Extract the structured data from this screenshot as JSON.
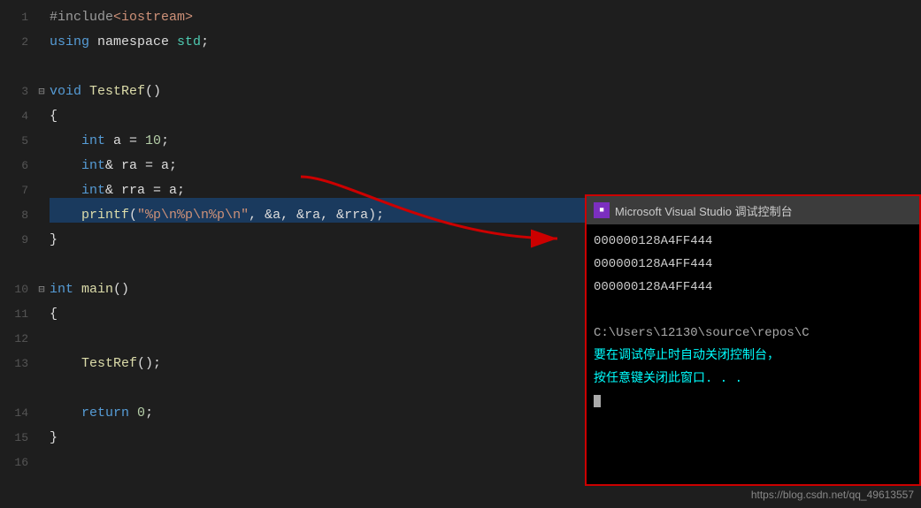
{
  "code": {
    "lines": [
      {
        "id": 1,
        "collapse": false,
        "content": [
          {
            "text": "#include",
            "cls": "preprocessor"
          },
          {
            "text": "<iostream>",
            "cls": "include-file"
          }
        ]
      },
      {
        "id": 2,
        "collapse": false,
        "content": [
          {
            "text": "using",
            "cls": "kw-purple"
          },
          {
            "text": " namespace ",
            "cls": "punct"
          },
          {
            "text": "std",
            "cls": "kw-green"
          },
          {
            "text": ";",
            "cls": "punct"
          }
        ]
      },
      {
        "id": 3,
        "collapse": false,
        "content": []
      },
      {
        "id": 4,
        "collapse": true,
        "content": [
          {
            "text": "void",
            "cls": "kw-blue"
          },
          {
            "text": " ",
            "cls": "punct"
          },
          {
            "text": "TestRef",
            "cls": "kw-yellow"
          },
          {
            "text": "()",
            "cls": "punct"
          }
        ]
      },
      {
        "id": 5,
        "collapse": false,
        "content": [
          {
            "text": "{",
            "cls": "punct"
          }
        ]
      },
      {
        "id": 6,
        "collapse": false,
        "content": [
          {
            "text": "    ",
            "cls": "punct"
          },
          {
            "text": "int",
            "cls": "kw-blue"
          },
          {
            "text": " a = ",
            "cls": "punct"
          },
          {
            "text": "10",
            "cls": "number"
          },
          {
            "text": ";",
            "cls": "punct"
          }
        ]
      },
      {
        "id": 7,
        "collapse": false,
        "content": [
          {
            "text": "    ",
            "cls": "punct"
          },
          {
            "text": "int",
            "cls": "kw-blue"
          },
          {
            "text": "& ra = a;",
            "cls": "punct"
          }
        ]
      },
      {
        "id": 8,
        "collapse": false,
        "content": [
          {
            "text": "    ",
            "cls": "punct"
          },
          {
            "text": "int",
            "cls": "kw-blue"
          },
          {
            "text": "& rra = a;",
            "cls": "punct"
          }
        ]
      },
      {
        "id": 9,
        "collapse": false,
        "highlight": true,
        "content": [
          {
            "text": "    ",
            "cls": "punct"
          },
          {
            "text": "printf",
            "cls": "kw-yellow"
          },
          {
            "text": "(",
            "cls": "punct"
          },
          {
            "text": "\"%p\\n%p\\n%p\\n\"",
            "cls": "str-orange"
          },
          {
            "text": ", &a, &ra, &rra);",
            "cls": "punct"
          }
        ]
      },
      {
        "id": 10,
        "collapse": false,
        "content": [
          {
            "text": "}",
            "cls": "punct"
          }
        ]
      },
      {
        "id": 11,
        "collapse": false,
        "content": []
      },
      {
        "id": 12,
        "collapse": true,
        "content": [
          {
            "text": "int",
            "cls": "kw-blue"
          },
          {
            "text": " ",
            "cls": "punct"
          },
          {
            "text": "main",
            "cls": "kw-yellow"
          },
          {
            "text": "()",
            "cls": "punct"
          }
        ]
      },
      {
        "id": 13,
        "collapse": false,
        "content": [
          {
            "text": "{",
            "cls": "punct"
          }
        ]
      },
      {
        "id": 14,
        "collapse": false,
        "content": []
      },
      {
        "id": 15,
        "collapse": false,
        "content": [
          {
            "text": "    ",
            "cls": "punct"
          },
          {
            "text": "TestRef",
            "cls": "kw-yellow"
          },
          {
            "text": "();",
            "cls": "punct"
          }
        ]
      },
      {
        "id": 16,
        "collapse": false,
        "content": []
      },
      {
        "id": 17,
        "collapse": false,
        "content": [
          {
            "text": "    ",
            "cls": "punct"
          },
          {
            "text": "return",
            "cls": "kw-blue"
          },
          {
            "text": " ",
            "cls": "punct"
          },
          {
            "text": "0",
            "cls": "number"
          },
          {
            "text": ";",
            "cls": "punct"
          }
        ]
      },
      {
        "id": 18,
        "collapse": false,
        "content": [
          {
            "text": "}",
            "cls": "punct"
          }
        ]
      }
    ]
  },
  "console": {
    "title": "Microsoft Visual Studio 调试控制台",
    "icon_text": "VS",
    "output_lines": [
      "000000128A4FF444",
      "000000128A4FF444",
      "000000128A4FF444",
      "",
      "C:\\Users\\12130\\source\\repos\\C",
      "要在调试停止时自动关闭控制台，",
      "按任意键关闭此窗口. . ."
    ]
  },
  "watermark": "https://blog.csdn.net/qq_49613557"
}
